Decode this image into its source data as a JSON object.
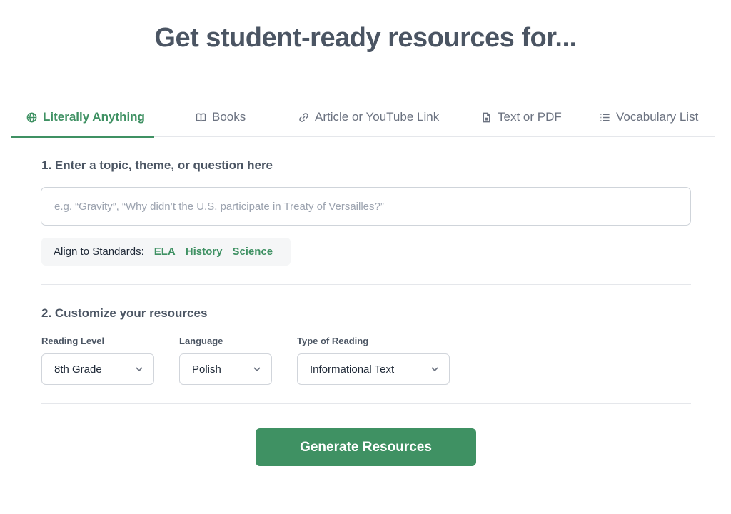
{
  "page": {
    "title": "Get student-ready resources for..."
  },
  "tabs": [
    {
      "label": "Literally Anything",
      "icon": "globe-icon",
      "active": true
    },
    {
      "label": "Books",
      "icon": "book-icon",
      "active": false
    },
    {
      "label": "Article or YouTube Link",
      "icon": "link-icon",
      "active": false
    },
    {
      "label": "Text or PDF",
      "icon": "document-icon",
      "active": false
    },
    {
      "label": "Vocabulary List",
      "icon": "list-icon",
      "active": false
    }
  ],
  "topic": {
    "heading": "1. Enter a topic, theme, or question here",
    "placeholder": "e.g. “Gravity”, “Why didn’t the U.S. participate in Treaty of Versailles?”",
    "value": ""
  },
  "standards": {
    "label": "Align to Standards:",
    "options": [
      "ELA",
      "History",
      "Science"
    ]
  },
  "customize": {
    "heading": "2. Customize your resources",
    "reading_level": {
      "label": "Reading Level",
      "value": "8th Grade"
    },
    "language": {
      "label": "Language",
      "value": "Polish"
    },
    "reading_type": {
      "label": "Type of Reading",
      "value": "Informational Text"
    }
  },
  "actions": {
    "generate_label": "Generate Resources"
  },
  "colors": {
    "accent": "#3f9163",
    "text": "#4b5563",
    "border": "#d1d5db"
  }
}
